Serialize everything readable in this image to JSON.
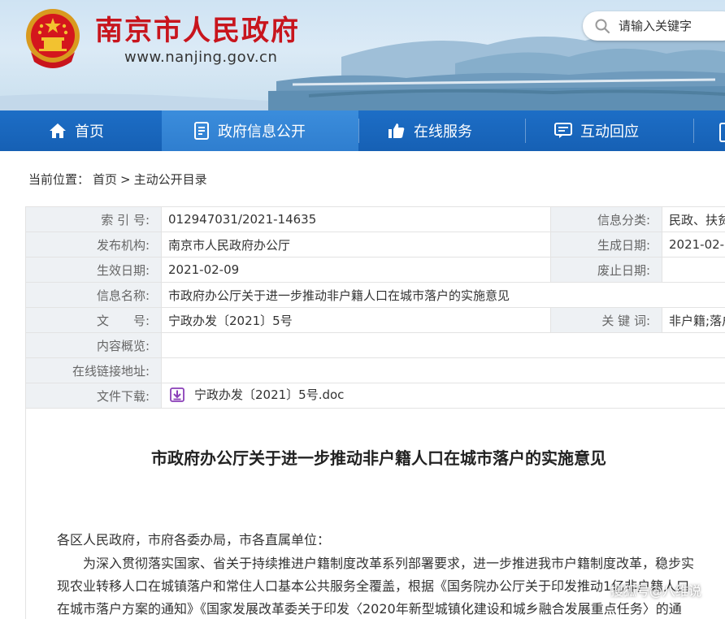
{
  "header": {
    "site_title": "南京市人民政府",
    "site_url": "www.nanjing.gov.cn",
    "search_placeholder": "请输入关键字"
  },
  "nav": {
    "items": [
      {
        "label": "首页",
        "icon": "home-icon"
      },
      {
        "label": "政府信息公开",
        "icon": "document-icon"
      },
      {
        "label": "在线服务",
        "icon": "thumbs-up-icon"
      },
      {
        "label": "互动回应",
        "icon": "chat-icon"
      }
    ]
  },
  "breadcrumb": {
    "prefix": "当前位置：",
    "items": [
      "首页",
      ">",
      "主动公开目录"
    ]
  },
  "info": {
    "index_no_label": "索 引 号:",
    "index_no": "012947031/2021-14635",
    "category_label": "信息分类:",
    "category": "民政、扶贫",
    "publisher_label": "发布机构:",
    "publisher": "南京市人民政府办公厅",
    "created_label": "生成日期:",
    "created": "2021-02-",
    "effective_label": "生效日期:",
    "effective": "2021-02-09",
    "abolished_label": "废止日期:",
    "abolished": "",
    "name_label": "信息名称:",
    "name": "市政府办公厅关于进一步推动非户籍人口在城市落户的实施意见",
    "doc_no_label": "文　　号:",
    "doc_no": "宁政办发〔2021〕5号",
    "keywords_label": "关 键 词:",
    "keywords": "非户籍;落户",
    "summary_label": "内容概览:",
    "summary": "",
    "online_link_label": "在线链接地址:",
    "online_link": "",
    "download_label": "文件下载:",
    "download_file": "宁政办发〔2021〕5号.doc"
  },
  "article": {
    "title": "市政府办公厅关于进一步推动非户籍人口在城市落户的实施意见",
    "greeting": "各区人民政府，市府各委办局，市各直属单位：",
    "line1": "为深入贯彻落实国家、省关于持续推进户籍制度改革系列部署要求，进一步推进我市户籍制度改革，稳步实",
    "line2": "现农业转移人口在城镇落户和常住人口基本公共服务全覆盖，根据《国务院办公厅关于印发推动1亿非户籍人口",
    "line3": "在城市落户方案的通知》《国家发展改革委关于印发〈2020年新型城镇化建设和城乡融合发展重点任务〉的通"
  },
  "watermark": "搜狐号@八维说",
  "colors": {
    "brand_red": "#c8151d",
    "nav_blue": "#1660b4",
    "nav_active": "#3b8ddc",
    "label_bg": "#eef1f4"
  }
}
